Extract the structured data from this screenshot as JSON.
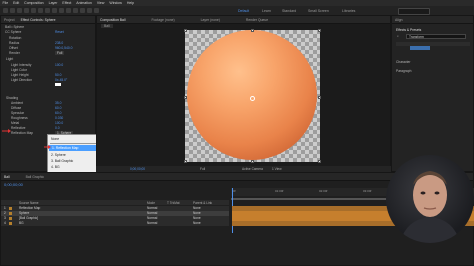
{
  "menu": [
    "File",
    "Edit",
    "Composition",
    "Layer",
    "Effect",
    "Animation",
    "View",
    "Window",
    "Help"
  ],
  "workspaces": [
    "Default",
    "Learn",
    "Standard",
    "Small Screen",
    "Libraries"
  ],
  "left_panel": {
    "tabs": [
      "Project",
      "Effect Controls: Sphere"
    ],
    "layer": "Ball • Sphere",
    "rows": [
      {
        "label": "CC Sphere",
        "value": "Reset"
      },
      {
        "label": "Rotation",
        "value": ""
      },
      {
        "label": "Radius",
        "value": "238.0"
      },
      {
        "label": "Offset",
        "value": "960.0,540.0"
      },
      {
        "label": "Render",
        "value": "Full"
      },
      {
        "label": "Light",
        "value": ""
      },
      {
        "label": "Light Intensity",
        "value": "100.0"
      },
      {
        "label": "Light Color",
        "value": ""
      },
      {
        "label": "Light Height",
        "value": "50.0"
      },
      {
        "label": "Light Direction",
        "value": "0x-45.0°"
      },
      {
        "label": "Shading",
        "value": ""
      },
      {
        "label": "Ambient",
        "value": "35.0"
      },
      {
        "label": "Diffuse",
        "value": "60.0"
      },
      {
        "label": "Specular",
        "value": "60.0"
      },
      {
        "label": "Roughness",
        "value": "0.030"
      },
      {
        "label": "Metal",
        "value": "100.0"
      },
      {
        "label": "Reflective",
        "value": "0.0"
      },
      {
        "label": "Reflection Map",
        "value": "1. Sphere"
      }
    ]
  },
  "dropdown": {
    "items": [
      "None",
      "1. Reflection Map",
      "2. Sphere",
      "3. Ball Graphic",
      "4. BG"
    ],
    "highlighted_index": 1
  },
  "viewer": {
    "tabs": [
      "Composition Ball",
      "Footage (none)",
      "Layer (none)",
      "Render Queue"
    ],
    "comp_tab": "Ball",
    "zoom": "Full",
    "camera": "Active Camera",
    "views": "1 View"
  },
  "right_panel": {
    "title": "Effects & Presets",
    "sections": [
      "Align",
      "Effects & Presets",
      "Character",
      "Paragraph"
    ],
    "search": "Transform"
  },
  "timeline": {
    "tabs": [
      "Ball",
      "Ball Graphic"
    ],
    "timecode": "0;00;00;00",
    "header": [
      "Source Name",
      "Mode",
      "T TrkMat",
      "Parent & Link"
    ],
    "layers": [
      {
        "num": "1",
        "name": "Reflection Map",
        "mode": "Normal",
        "parent": "None",
        "color": "#b8762c"
      },
      {
        "num": "2",
        "name": "Sphere",
        "mode": "Normal",
        "parent": "None",
        "color": "#c67f2d"
      },
      {
        "num": "3",
        "name": "[Ball Graphic]",
        "mode": "Normal",
        "parent": "None",
        "color": "#c67f2d"
      },
      {
        "num": "4",
        "name": "BG",
        "mode": "Normal",
        "parent": "None",
        "color": "#b8762c"
      }
    ],
    "ruler": [
      "0f",
      "01:00f",
      "02:00f",
      "03:00f",
      "04:00f",
      "05:00f"
    ]
  },
  "colors": {
    "accent": "#4e8fe6",
    "layer_bar": "#c67f2d",
    "arrow": "#e23333"
  }
}
